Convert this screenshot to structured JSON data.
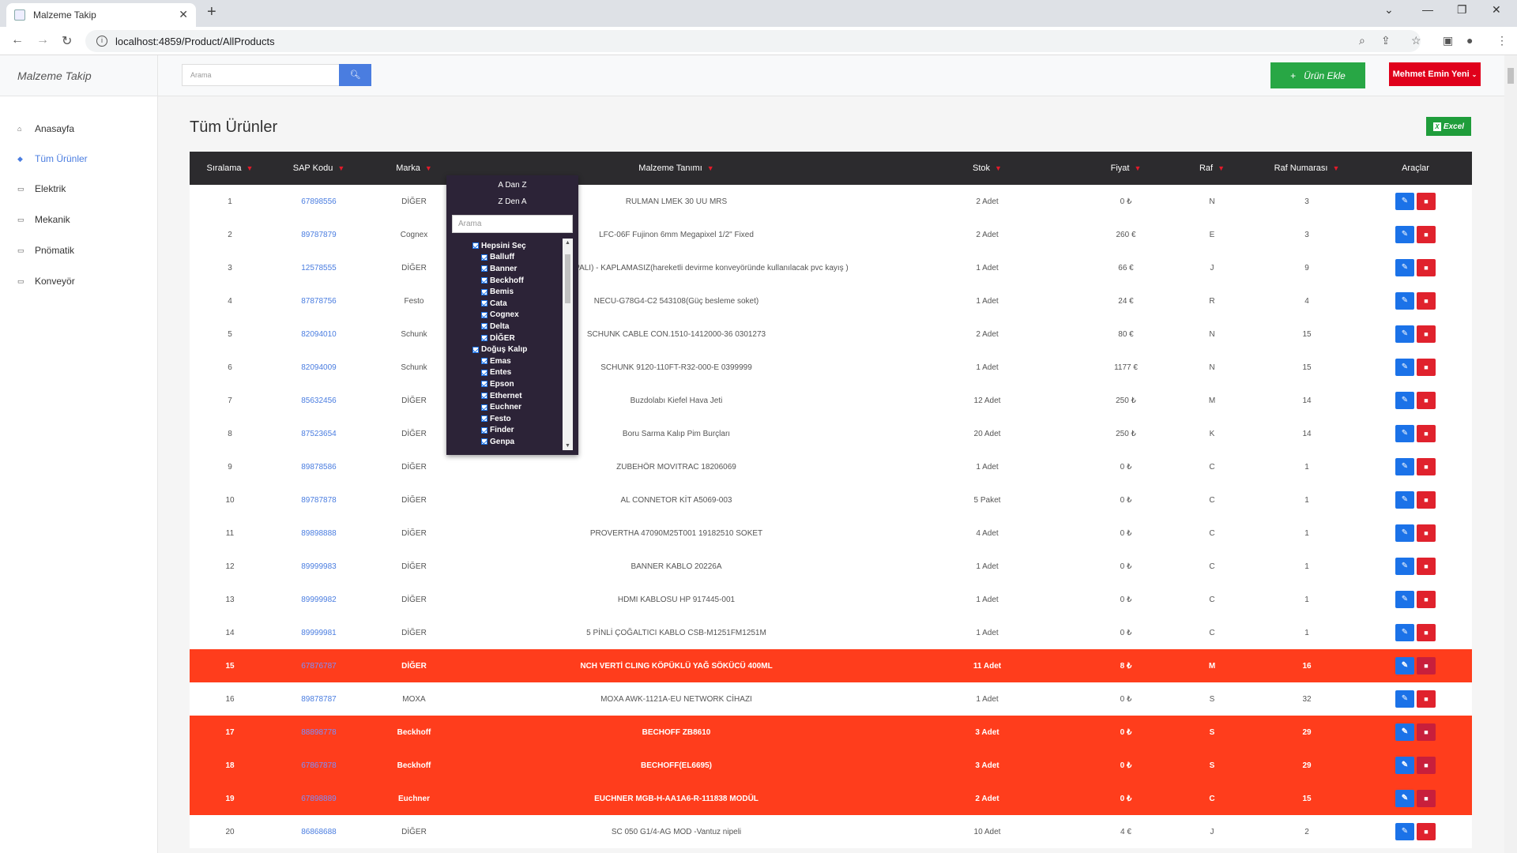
{
  "browser": {
    "tab_title": "Malzeme Takip",
    "url": "localhost:4859/Product/AllProducts"
  },
  "header": {
    "brand": "Malzeme Takip",
    "search_placeholder": "Arama",
    "add_button": "Ürün Ekle",
    "user_button": "Mehmet Emin Yeni"
  },
  "sidebar": {
    "items": [
      {
        "label": "Anasayfa",
        "icon": "home-icon"
      },
      {
        "label": "Tüm Ürünler",
        "icon": "gem-icon"
      },
      {
        "label": "Elektrik",
        "icon": "folder-icon"
      },
      {
        "label": "Mekanik",
        "icon": "folder-icon"
      },
      {
        "label": "Pnömatik",
        "icon": "folder-icon"
      },
      {
        "label": "Konveyör",
        "icon": "folder-icon"
      }
    ]
  },
  "main": {
    "title": "Tüm Ürünler",
    "excel_button": "Excel",
    "columns": [
      "Sıralama",
      "SAP Kodu",
      "Marka",
      "Malzeme Tanımı",
      "Stok",
      "Fiyat",
      "Raf",
      "Raf Numarası",
      "Araçlar"
    ],
    "rows": [
      {
        "n": "1",
        "sap": "67898556",
        "brand": "DİĞER",
        "desc": "RULMAN LMEK 30 UU MRS",
        "stock": "2 Adet",
        "price": "0 ₺",
        "shelf": "N",
        "shelf_no": "3",
        "hl": false
      },
      {
        "n": "2",
        "sap": "89787879",
        "brand": "Cognex",
        "desc": "LFC-06F Fujinon 6mm Megapixel 1/2\" Fixed",
        "stock": "2 Adet",
        "price": "260 €",
        "shelf": "E",
        "shelf_no": "3",
        "hl": false
      },
      {
        "n": "3",
        "sap": "12578555",
        "brand": "DİĞER",
        "desc": "1050 MM - EKLİ(KAPALI) - KAPLAMASIZ(hareketli devirme konveyöründe kullanılacak pvc kayış )",
        "stock": "1 Adet",
        "price": "66 €",
        "shelf": "J",
        "shelf_no": "9",
        "hl": false
      },
      {
        "n": "4",
        "sap": "87878756",
        "brand": "Festo",
        "desc": "NECU-G78G4-C2 543108(Güç besleme soket)",
        "stock": "1 Adet",
        "price": "24 €",
        "shelf": "R",
        "shelf_no": "4",
        "hl": false
      },
      {
        "n": "5",
        "sap": "82094010",
        "brand": "Schunk",
        "desc": "SCHUNK CABLE CON.1510-1412000-36 0301273",
        "stock": "2 Adet",
        "price": "80 €",
        "shelf": "N",
        "shelf_no": "15",
        "hl": false
      },
      {
        "n": "6",
        "sap": "82094009",
        "brand": "Schunk",
        "desc": "SCHUNK 9120-110FT-R32-000-E 0399999",
        "stock": "1 Adet",
        "price": "1177 €",
        "shelf": "N",
        "shelf_no": "15",
        "hl": false
      },
      {
        "n": "7",
        "sap": "85632456",
        "brand": "DİĞER",
        "desc": "Buzdolabı Kiefel Hava Jeti",
        "stock": "12 Adet",
        "price": "250 ₺",
        "shelf": "M",
        "shelf_no": "14",
        "hl": false
      },
      {
        "n": "8",
        "sap": "87523654",
        "brand": "DİĞER",
        "desc": "Boru Sarma Kalıp Pim Burçları",
        "stock": "20 Adet",
        "price": "250 ₺",
        "shelf": "K",
        "shelf_no": "14",
        "hl": false
      },
      {
        "n": "9",
        "sap": "89878586",
        "brand": "DİĞER",
        "desc": "ZUBEHÖR MOVITRAC 18206069",
        "stock": "1 Adet",
        "price": "0 ₺",
        "shelf": "C",
        "shelf_no": "1",
        "hl": false
      },
      {
        "n": "10",
        "sap": "89787878",
        "brand": "DİĞER",
        "desc": "AL CONNETOR KİT A5069-003",
        "stock": "5 Paket",
        "price": "0 ₺",
        "shelf": "C",
        "shelf_no": "1",
        "hl": false
      },
      {
        "n": "11",
        "sap": "89898888",
        "brand": "DİĞER",
        "desc": "PROVERTHA 47090M25T001 19182510 SOKET",
        "stock": "4 Adet",
        "price": "0 ₺",
        "shelf": "C",
        "shelf_no": "1",
        "hl": false
      },
      {
        "n": "12",
        "sap": "89999983",
        "brand": "DİĞER",
        "desc": "BANNER KABLO 20226A",
        "stock": "1 Adet",
        "price": "0 ₺",
        "shelf": "C",
        "shelf_no": "1",
        "hl": false
      },
      {
        "n": "13",
        "sap": "89999982",
        "brand": "DİĞER",
        "desc": "HDMI KABLOSU HP 917445-001",
        "stock": "1 Adet",
        "price": "0 ₺",
        "shelf": "C",
        "shelf_no": "1",
        "hl": false
      },
      {
        "n": "14",
        "sap": "89999981",
        "brand": "DİĞER",
        "desc": "5 PİNLİ ÇOĞALTICI KABLO CSB-M1251FM1251M",
        "stock": "1 Adet",
        "price": "0 ₺",
        "shelf": "C",
        "shelf_no": "1",
        "hl": false
      },
      {
        "n": "15",
        "sap": "67876787",
        "brand": "DİĞER",
        "desc": "NCH VERTİ CLING KÖPÜKLÜ YAĞ SÖKÜCÜ 400ML",
        "stock": "11 Adet",
        "price": "8 ₺",
        "shelf": "M",
        "shelf_no": "16",
        "hl": true
      },
      {
        "n": "16",
        "sap": "89878787",
        "brand": "MOXA",
        "desc": "MOXA AWK-1121A-EU NETWORK CİHAZI",
        "stock": "1 Adet",
        "price": "0 ₺",
        "shelf": "S",
        "shelf_no": "32",
        "hl": false
      },
      {
        "n": "17",
        "sap": "88898778",
        "brand": "Beckhoff",
        "desc": "BECHOFF ZB8610",
        "stock": "3 Adet",
        "price": "0 ₺",
        "shelf": "S",
        "shelf_no": "29",
        "hl": true
      },
      {
        "n": "18",
        "sap": "67867878",
        "brand": "Beckhoff",
        "desc": "BECHOFF(EL6695)",
        "stock": "3 Adet",
        "price": "0 ₺",
        "shelf": "S",
        "shelf_no": "29",
        "hl": true
      },
      {
        "n": "19",
        "sap": "67898889",
        "brand": "Euchner",
        "desc": "EUCHNER MGB-H-AA1A6-R-111838 MODÜL",
        "stock": "2 Adet",
        "price": "0 ₺",
        "shelf": "C",
        "shelf_no": "15",
        "hl": true
      },
      {
        "n": "20",
        "sap": "86868688",
        "brand": "DİĞER",
        "desc": "SC 050 G1/4-AG MOD -Vantuz nipeli",
        "stock": "10 Adet",
        "price": "4 €",
        "shelf": "J",
        "shelf_no": "2",
        "hl": false
      }
    ]
  },
  "filter": {
    "sort_az": "A Dan Z",
    "sort_za": "Z Den A",
    "search_placeholder": "Arama",
    "items": [
      {
        "label": "Hepsini Seç",
        "indent": false
      },
      {
        "label": "Balluff",
        "indent": true
      },
      {
        "label": "Banner",
        "indent": true
      },
      {
        "label": "Beckhoff",
        "indent": true
      },
      {
        "label": "Bemis",
        "indent": true
      },
      {
        "label": "Cata",
        "indent": true
      },
      {
        "label": "Cognex",
        "indent": true
      },
      {
        "label": "Delta",
        "indent": true
      },
      {
        "label": "DİĞER",
        "indent": true
      },
      {
        "label": "Doğuş Kalıp",
        "indent": false
      },
      {
        "label": "Emas",
        "indent": true
      },
      {
        "label": "Entes",
        "indent": true
      },
      {
        "label": "Epson",
        "indent": true
      },
      {
        "label": "Ethernet",
        "indent": true
      },
      {
        "label": "Euchner",
        "indent": true
      },
      {
        "label": "Festo",
        "indent": true
      },
      {
        "label": "Finder",
        "indent": true
      },
      {
        "label": "Genpa",
        "indent": true
      }
    ]
  }
}
